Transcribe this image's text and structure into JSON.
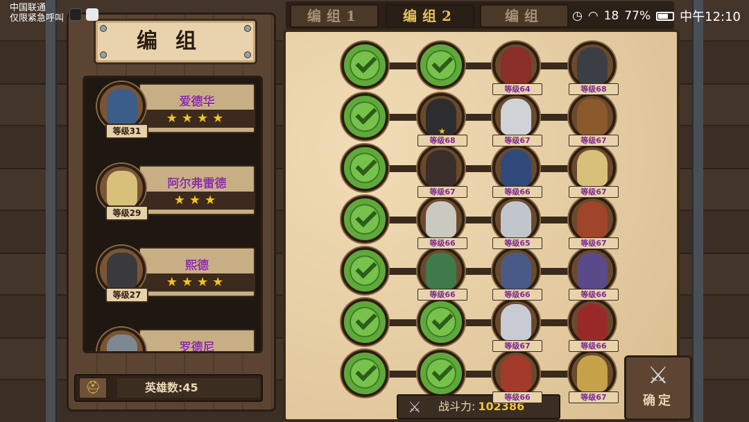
{
  "status": {
    "carrier": "中国联通",
    "emergency": "仅限紧急呼叫",
    "battery": "77%",
    "time": "中午12:10",
    "signal_text": "18"
  },
  "title": "编组",
  "tabs": [
    {
      "label": "编组1",
      "active": false
    },
    {
      "label": "编组2",
      "active": true
    },
    {
      "label": "编组",
      "active": false
    }
  ],
  "heroes": [
    {
      "name": "爱德华",
      "level": "等级31",
      "stars": "★★★★",
      "color": "#3b5d8a"
    },
    {
      "name": "阿尔弗雷德",
      "level": "等级29",
      "stars": "★★★",
      "color": "#d8c07a"
    },
    {
      "name": "熙德",
      "level": "等级27",
      "stars": "★★★★",
      "color": "#3a3a3e"
    },
    {
      "name": "罗德尼",
      "level": "",
      "stars": "★★★",
      "color": "#7d8893"
    }
  ],
  "hero_count": "英雄数:45",
  "grid": [
    [
      {
        "type": "check"
      },
      {
        "type": "check"
      },
      {
        "type": "hero",
        "level": "等级64",
        "color": "#8a2f2a"
      },
      {
        "type": "hero",
        "level": "等级68",
        "color": "#3b3e44"
      }
    ],
    [
      {
        "type": "check"
      },
      {
        "type": "hero",
        "level": "等级68",
        "color": "#2d2d30",
        "star": true
      },
      {
        "type": "hero",
        "level": "等级67",
        "color": "#cfd3d8"
      },
      {
        "type": "hero",
        "level": "等级67",
        "color": "#8a5a2c"
      }
    ],
    [
      {
        "type": "check"
      },
      {
        "type": "hero",
        "level": "等级67",
        "color": "#3a2e2a"
      },
      {
        "type": "hero",
        "level": "等级66",
        "color": "#2f4a7a"
      },
      {
        "type": "hero",
        "level": "等级67",
        "color": "#d8c07a"
      }
    ],
    [
      {
        "type": "check"
      },
      {
        "type": "hero",
        "level": "等级66",
        "color": "#c9c9c2"
      },
      {
        "type": "hero",
        "level": "等级65",
        "color": "#c0c6cc"
      },
      {
        "type": "hero",
        "level": "等级67",
        "color": "#a0452a"
      }
    ],
    [
      {
        "type": "check"
      },
      {
        "type": "hero",
        "level": "等级66",
        "color": "#3f7a4a"
      },
      {
        "type": "hero",
        "level": "等级66",
        "color": "#4a5a86"
      },
      {
        "type": "hero",
        "level": "等级66",
        "color": "#5a4a8a"
      }
    ],
    [
      {
        "type": "check"
      },
      {
        "type": "check"
      },
      {
        "type": "hero",
        "level": "等级67",
        "color": "#c8ccd2"
      },
      {
        "type": "hero",
        "level": "等级66",
        "color": "#9a2a2a"
      }
    ],
    [
      {
        "type": "check"
      },
      {
        "type": "check"
      },
      {
        "type": "hero",
        "level": "等级66",
        "color": "#a33a2a"
      },
      {
        "type": "hero",
        "level": "等级67",
        "color": "#c7a24a"
      }
    ]
  ],
  "power": {
    "label": "战斗力:",
    "value": "102386"
  },
  "confirm_label": "确定",
  "colors": {
    "parchment": "#e8d2a7",
    "wood": "#5a4332",
    "check": "#5fa93b",
    "purple_text": "#8b2fa0",
    "gold": "#f2c437"
  }
}
